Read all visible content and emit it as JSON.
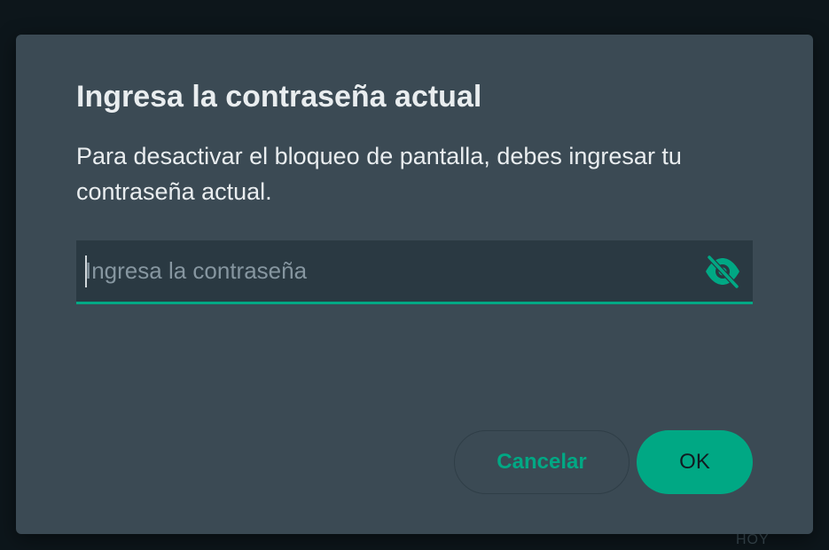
{
  "dialog": {
    "title": "Ingresa la contraseña actual",
    "description": "Para desactivar el bloqueo de pantalla, debes ingresar tu contraseña actual.",
    "password_field": {
      "value": "",
      "placeholder": "Ingresa la contraseña",
      "toggle_icon": "eye-off-icon"
    },
    "cancel_label": "Cancelar",
    "ok_label": "OK"
  },
  "background": {
    "partial_label": "HOY"
  },
  "colors": {
    "accent": "#00a884",
    "dialog_bg": "#3b4a54",
    "input_bg": "#2a3942",
    "text": "#e9edef",
    "placeholder": "#8696a0"
  }
}
